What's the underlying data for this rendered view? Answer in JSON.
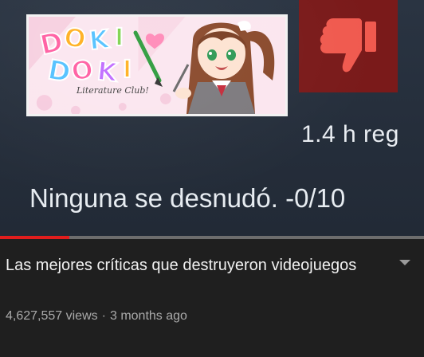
{
  "thumbnail": {
    "game_logo": {
      "letters": "DOKI DOKI",
      "subtitle": "Literature Club!",
      "colors": [
        "#ff5fa2",
        "#53c1ff",
        "#ffb020",
        "#7fd34e",
        "#c06cff"
      ]
    },
    "review": {
      "verdict_icon": "thumbs-down-icon",
      "verdict_color": "#f05a4f",
      "hours": "1.4 h reg",
      "text": "Ninguna se desnudó. -0/10"
    }
  },
  "player": {
    "progress": 0.163,
    "progress_color": "#e01d1d"
  },
  "video": {
    "title": "Las mejores críticas que destruyeron videojuegos",
    "views": "4,627,557 views",
    "separator": "·",
    "age": "3 months ago",
    "menu_icon": "chevron-down-icon"
  }
}
